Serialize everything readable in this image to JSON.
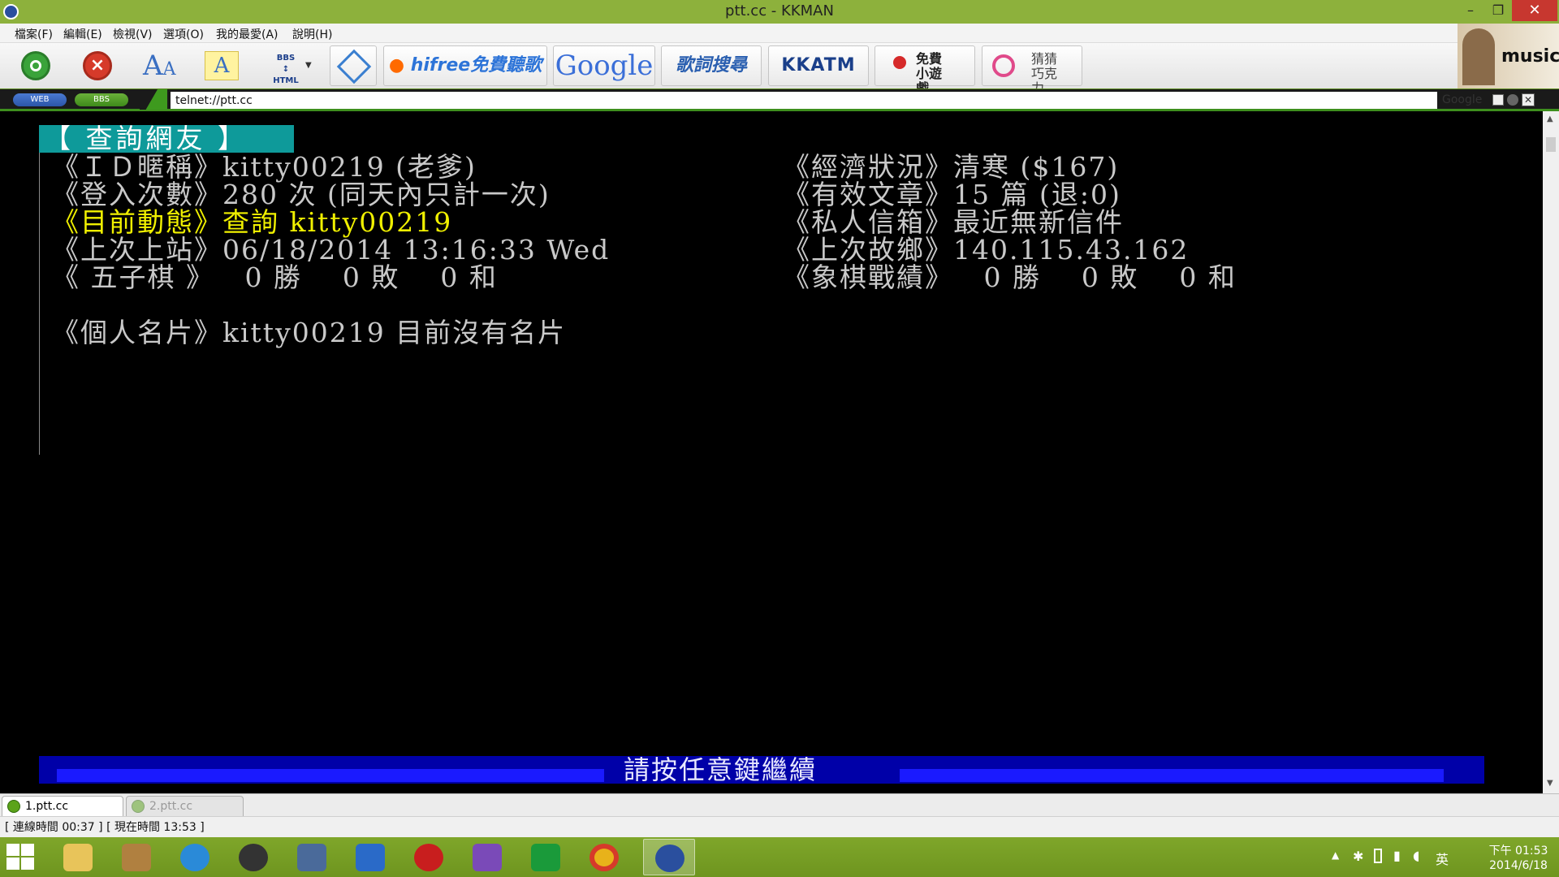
{
  "window": {
    "title": "ptt.cc - KKMAN",
    "minimize": "–",
    "maximize": "❐",
    "close": "✕"
  },
  "menu": [
    "檔案(F)",
    "編輯(E)",
    "檢視(V)",
    "選項(O)",
    "我的最愛(A)",
    "說明(H)"
  ],
  "toolbar": {
    "bbs_html_top": "BBS",
    "bbs_html_bottom": "HTML",
    "hifree": "hifree免費聽歌",
    "google": "Google",
    "lyrics": "歌詞搜尋",
    "kkatm": "KKATM",
    "free_games": "免費小遊戲",
    "guess": "猜猜巧克力",
    "banner": "music"
  },
  "address": {
    "web_pill": "WEB",
    "bbs_pill": "BBS",
    "url": "telnet://ptt.cc",
    "search_engine": "Google"
  },
  "terminal": {
    "header": "【 查詢網友 】",
    "left": [
      "《ＩＤ暱稱》kitty00219 (老爹)",
      "《登入次數》280 次 (同天內只計一次)",
      "《目前動態》查詢 kitty00219",
      "《上次上站》06/18/2014 13:16:33 Wed",
      "《 五子棋 》   0 勝    0 敗    0 和"
    ],
    "right": [
      "《經濟狀況》清寒 ($167)",
      "《有效文章》15 篇 (退:0)",
      "《私人信箱》最近無新信件",
      "《上次故鄉》140.115.43.162",
      "《象棋戰績》   0 勝    0 敗    0 和"
    ],
    "card": "《個人名片》kitty00219 目前沒有名片",
    "press_any_key": "請按任意鍵繼續"
  },
  "tabs": [
    {
      "label": "1.ptt.cc"
    },
    {
      "label": "2.ptt.cc"
    }
  ],
  "status": {
    "text": "[ 連線時間 00:37 ] [ 現在時間 13:53 ]"
  },
  "tray": {
    "lang": "英",
    "time": "下午 01:53",
    "date": "2014/6/18"
  },
  "colors": {
    "titlebar": "#8db13c",
    "terminal_bg": "#000000",
    "header_bg": "#0e9a9a",
    "highlight": "#f0f000",
    "pressbar": "#0000a8"
  }
}
